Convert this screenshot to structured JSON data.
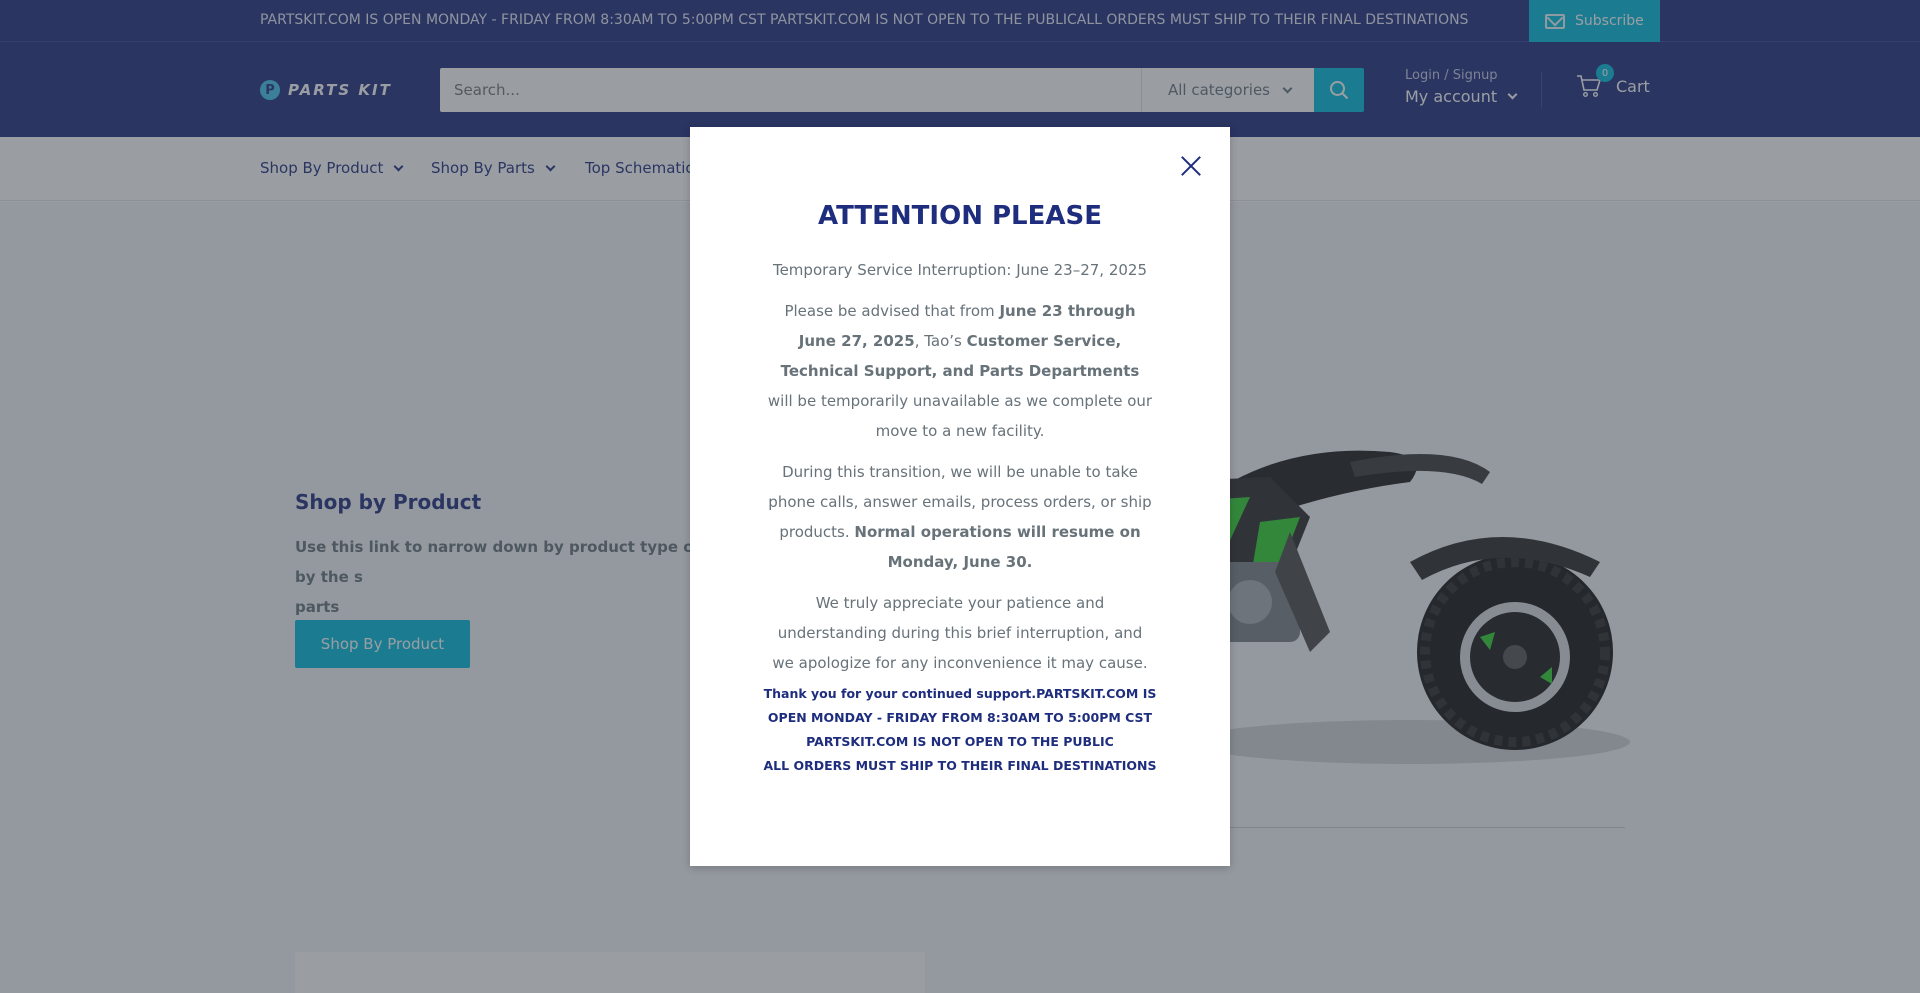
{
  "announcement": {
    "text": "PARTSKIT.COM IS OPEN MONDAY - FRIDAY FROM 8:30AM TO 5:00PM CST PARTSKIT.COM IS NOT OPEN TO THE PUBLICALL ORDERS MUST SHIP TO THEIR FINAL DESTINATIONS",
    "subscribe_label": "Subscribe",
    "subscribe_icon": "mail-icon"
  },
  "header": {
    "logo_text": "PARTS KIT",
    "search_placeholder": "Search...",
    "category_label": "All categories",
    "login_label": "Login / Signup",
    "account_label": "My account",
    "cart_label": "Cart",
    "cart_count": "0"
  },
  "nav": {
    "items": [
      {
        "label": "Shop By Product"
      },
      {
        "label": "Shop By Parts"
      },
      {
        "label": "Top Schematics"
      }
    ]
  },
  "promo": {
    "title": "Shop by Product",
    "text": "Use this link to narrow down by product type or by the s",
    "text2": "parts",
    "button_label": "Shop By Product"
  },
  "modal": {
    "title": "ATTENTION PLEASE",
    "subtitle": "Temporary Service Interruption: June 23–27, 2025",
    "p1_a": "Please be advised that from ",
    "p1_b": "June 23 through June 27, 2025",
    "p1_c": ", Tao’s ",
    "p1_d": "Customer Service, Technical Support, and Parts Departments",
    "p1_e": " will be temporarily unavailable as we complete our move to a new facility.",
    "p2_a": "During this transition, we will be unable to take phone calls, answer emails, process orders, or ship products. ",
    "p2_b": "Normal operations will resume on Monday, June 30.",
    "p3": "We truly appreciate your patience and understanding during this brief interruption, and we apologize for any inconvenience it may cause.",
    "foot1": "Thank you for your continued support.PARTSKIT.COM IS OPEN MONDAY - FRIDAY FROM 8:30AM TO 5:00PM CST",
    "foot2": "PARTSKIT.COM IS NOT OPEN TO THE PUBLIC",
    "foot3": "ALL ORDERS MUST SHIP TO THEIR FINAL DESTINATIONS"
  },
  "colors": {
    "brand_navy": "#1e2d7d",
    "accent_cyan": "#00badb",
    "atv_green": "#2fd12f"
  }
}
